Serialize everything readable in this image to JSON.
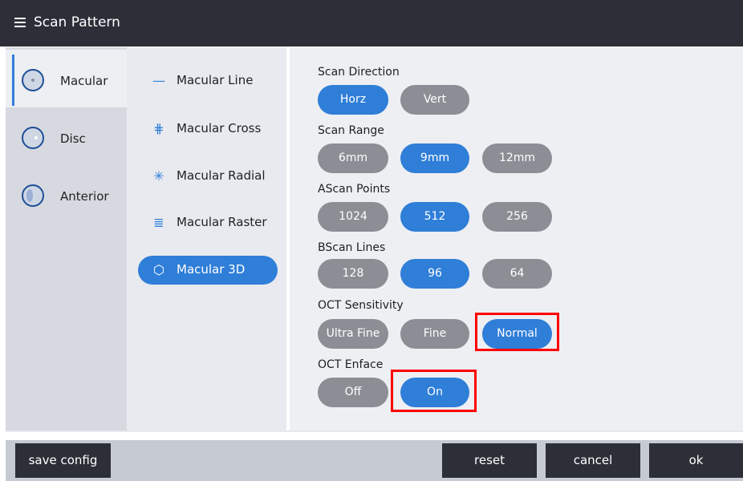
{
  "title": "Scan Pattern",
  "categories": [
    {
      "label": "Macular",
      "active": true
    },
    {
      "label": "Disc",
      "active": false
    },
    {
      "label": "Anterior",
      "active": false
    }
  ],
  "patterns": [
    {
      "label": "Macular Line",
      "icon": "—",
      "active": false
    },
    {
      "label": "Macular Cross",
      "icon": "⋕",
      "active": false
    },
    {
      "label": "Macular Radial",
      "icon": "✳",
      "active": false
    },
    {
      "label": "Macular Raster",
      "icon": "≣",
      "active": false
    },
    {
      "label": "Macular 3D",
      "icon": "⬡",
      "active": true
    }
  ],
  "settings": {
    "scan_direction": {
      "label": "Scan Direction",
      "options": [
        "Horz",
        "Vert"
      ],
      "selected": "Horz"
    },
    "scan_range": {
      "label": "Scan Range",
      "options": [
        "6mm",
        "9mm",
        "12mm"
      ],
      "selected": "9mm"
    },
    "ascan_points": {
      "label": "AScan Points",
      "options": [
        "1024",
        "512",
        "256"
      ],
      "selected": "512"
    },
    "bscan_lines": {
      "label": "BScan Lines",
      "options": [
        "128",
        "96",
        "64"
      ],
      "selected": "96"
    },
    "oct_sensitivity": {
      "label": "OCT Sensitivity",
      "options": [
        "Ultra Fine",
        "Fine",
        "Normal"
      ],
      "selected": "Normal"
    },
    "oct_enface": {
      "label": "OCT Enface",
      "options": [
        "Off",
        "On"
      ],
      "selected": "On"
    }
  },
  "footer": {
    "save_config": "save config",
    "reset": "reset",
    "cancel": "cancel",
    "ok": "ok"
  },
  "colors": {
    "accent": "#2f7ed8",
    "titlebar": "#2c2f38",
    "button_inactive": "#8b8e94",
    "highlight": "#ff0000"
  }
}
